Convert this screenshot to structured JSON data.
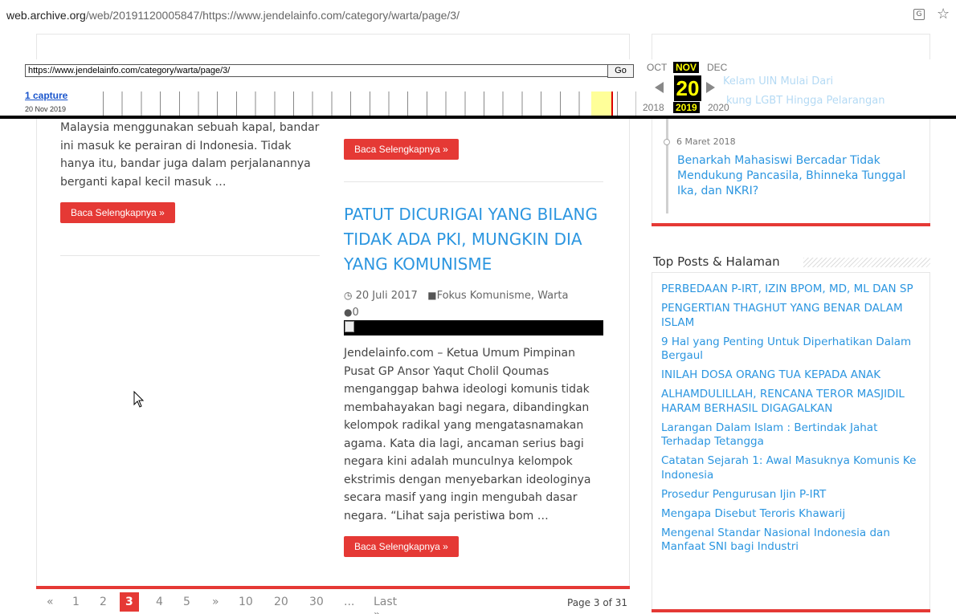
{
  "browser": {
    "url_host": "web.archive.org",
    "url_path": "/web/20191120005847/https://www.jendelainfo.com/category/warta/page/3/",
    "translate_icon": "translate-icon",
    "bookmark_icon": "star-icon"
  },
  "wayback": {
    "url_value": "https://www.jendelainfo.com/category/warta/page/3/",
    "go_label": "Go",
    "captures": "1 capture",
    "capture_date": "20 Nov 2019",
    "months": {
      "prev": "OCT",
      "current": "NOV",
      "next": "DEC"
    },
    "day": "20",
    "years": {
      "prev": "2018",
      "current": "2019",
      "next": "2020"
    },
    "behind_text_1": "Kelam UIN Mulai Dari",
    "behind_text_2": "kung LGBT Hingga Pelarangan"
  },
  "left_article": {
    "excerpt": "Malaysia menggunakan sebuah kapal, bandar ini masuk ke perairan di Indonesia. Tidak hanya itu, bandar juga dalam perjalanannya berganti kapal kecil masuk …",
    "read_more": "Baca Selengkapnya »"
  },
  "mid_article_prev": {
    "read_more": "Baca Selengkapnya »"
  },
  "mid_article": {
    "title": "PATUT DICURIGAI YANG BILANG TIDAK ADA PKI, MUNGKIN DIA YANG KOMUNISME",
    "date": "20 Juli 2017",
    "categories": "Fokus Komunisme, Warta",
    "comments": "0",
    "excerpt": "Jendelainfo.com – Ketua Umum Pimpinan Pusat GP Ansor Yaqut Cholil Qoumas menganggap bahwa ideologi komunis tidak membahayakan bagi negara, dibandingkan kelompok radikal yang mengatasnamakan agama. Kata dia lagi, ancaman serius bagi negara kini adalah munculnya kelompok ekstrimis dengan menyebarkan ideologinya secara masif yang ingin mengubah dasar negara. “Lihat saja peristiwa bom …",
    "read_more": "Baca Selengkapnya »"
  },
  "pagination": {
    "first": "«",
    "pages": [
      "1",
      "2",
      "3",
      "4",
      "5"
    ],
    "next": "»",
    "jumps": [
      "10",
      "20",
      "30"
    ],
    "ellipsis": "...",
    "last": "Last »",
    "page_of": "Page 3 of 31"
  },
  "sidebar": {
    "timeline": {
      "date": "6 Maret 2018",
      "title": "Benarkah Mahasiswi Bercadar Tidak Mendukung Pancasila, Bhinneka Tunggal Ika, dan NKRI?"
    },
    "top_posts_title": "Top Posts & Halaman",
    "top_posts": [
      "PERBEDAAN P-IRT, IZIN BPOM, MD, ML DAN SP",
      "PENGERTIAN THAGHUT YANG BENAR DALAM ISLAM",
      "9 Hal yang Penting Untuk Diperhatikan Dalam Bergaul",
      "INILAH DOSA ORANG TUA KEPADA ANAK",
      "ALHAMDULILLAH, RENCANA TEROR MASJIDIL HARAM BERHASIL DIGAGALKAN",
      "Larangan Dalam Islam : Bertindak Jahat Terhadap Tetangga",
      "Catatan Sejarah 1: Awal Masuknya Komunis Ke Indonesia",
      "Prosedur Pengurusan Ijin P-IRT",
      "Mengapa Disebut Teroris Khawarij",
      "Mengenal Standar Nasional Indonesia dan Manfaat SNI bagi Industri"
    ]
  },
  "colors": {
    "accent_red": "#e53935",
    "link_blue": "#2c96e0"
  }
}
